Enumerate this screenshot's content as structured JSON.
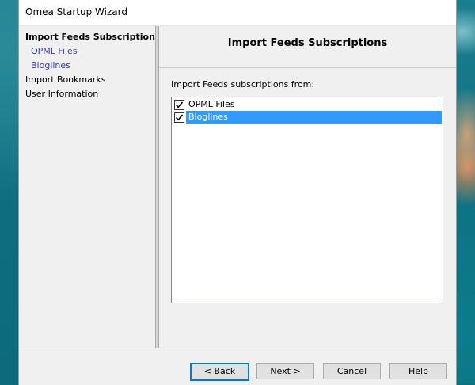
{
  "window": {
    "title": "Omea Startup Wizard"
  },
  "nav": {
    "items": [
      {
        "label": "Import Feeds Subscriptions",
        "level": 0,
        "active": true
      },
      {
        "label": "OPML Files",
        "level": 1
      },
      {
        "label": "Bloglines",
        "level": 1
      },
      {
        "label": "Import Bookmarks",
        "level": 0
      },
      {
        "label": "User Information",
        "level": 0
      }
    ]
  },
  "page": {
    "heading": "Import Feeds Subscriptions",
    "list_label": "Import Feeds subscriptions from:",
    "sources": [
      {
        "label": "OPML Files",
        "checked": true,
        "selected": false
      },
      {
        "label": "Bloglines",
        "checked": true,
        "selected": true
      }
    ]
  },
  "buttons": {
    "back": "< Back",
    "next": "Next >",
    "cancel": "Cancel",
    "help": "Help"
  },
  "colors": {
    "selection": "#3399ff",
    "nav_sub_link": "#3b3bb5",
    "default_button_border": "#0078d7"
  }
}
